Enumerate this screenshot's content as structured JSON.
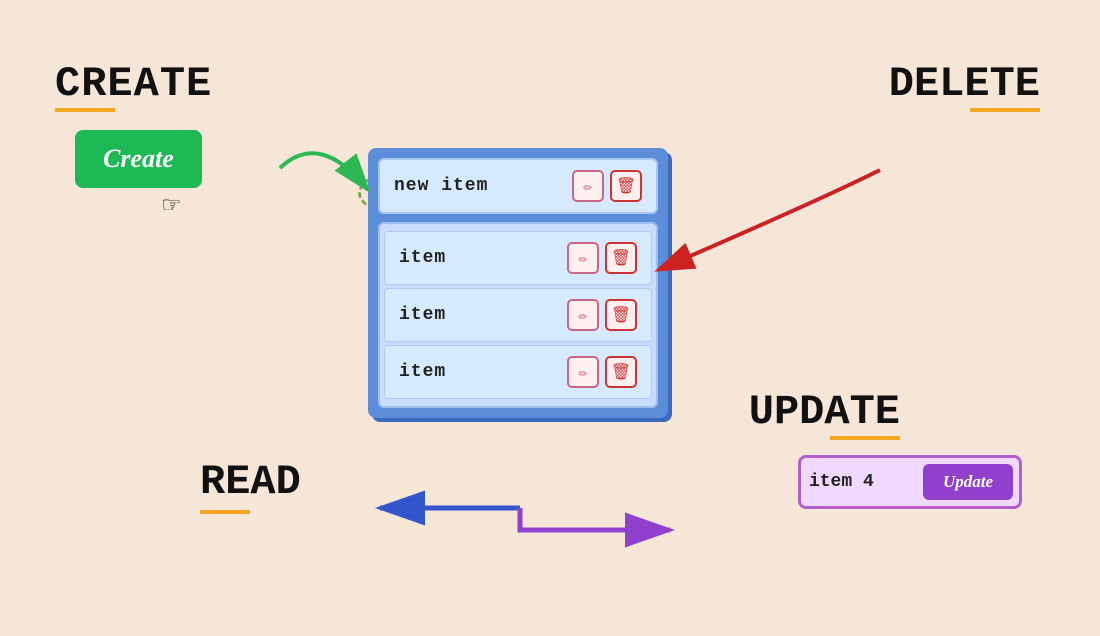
{
  "create": {
    "label": "CREATE",
    "underline_color": "#f5a623",
    "button_label": "Create"
  },
  "delete": {
    "label": "DELETE",
    "underline_color": "#f5a623"
  },
  "read": {
    "label": "READ",
    "underline_color": "#f5a623"
  },
  "update": {
    "label": "UPDATE",
    "underline_color": "#f5a623",
    "button_label": "Update"
  },
  "list": {
    "new_item_text": "new item",
    "items": [
      {
        "text": "item"
      },
      {
        "text": "item"
      },
      {
        "text": "item"
      }
    ]
  },
  "update_input": {
    "value": "item 4",
    "placeholder": ""
  },
  "icons": {
    "edit": "✏",
    "delete": "🗑",
    "cursor": "☞"
  }
}
